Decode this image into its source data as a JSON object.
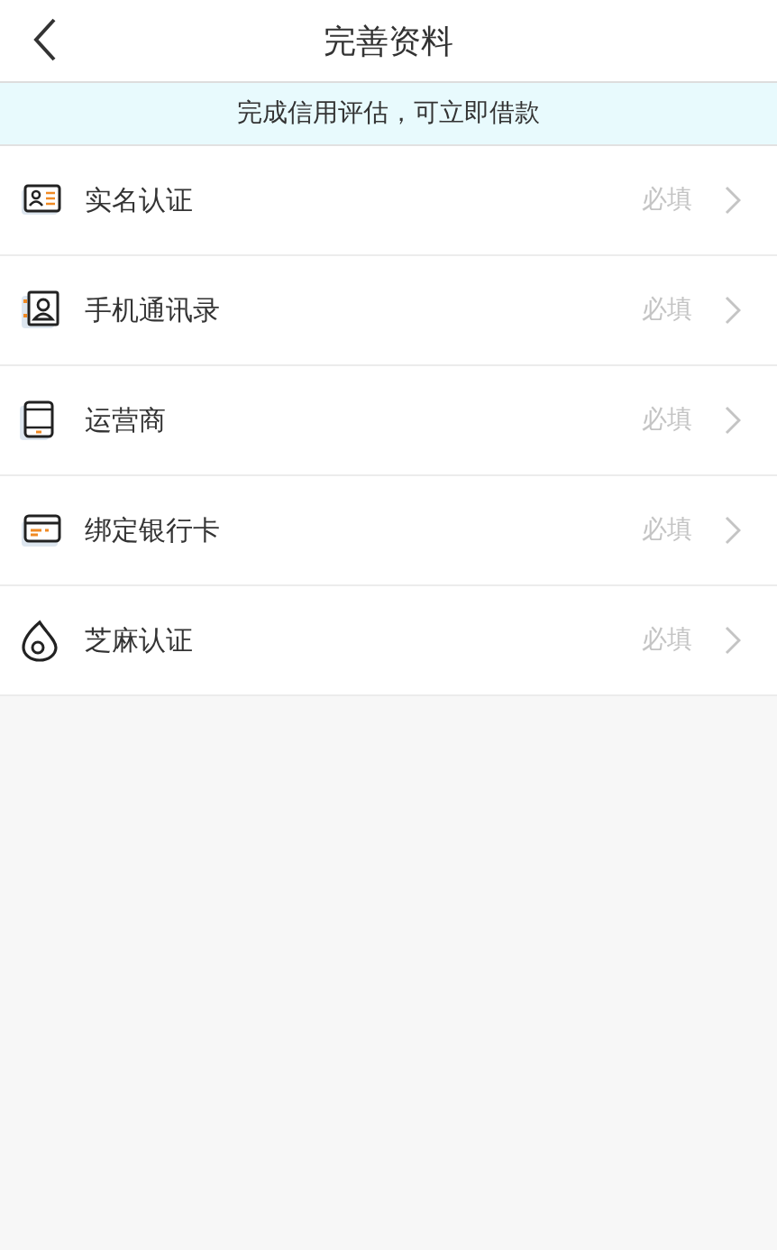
{
  "header": {
    "title": "完善资料"
  },
  "notice": "完成信用评估，可立即借款",
  "items": [
    {
      "kind": "id",
      "label": "实名认证",
      "status": "必填"
    },
    {
      "kind": "contacts",
      "label": "手机通讯录",
      "status": "必填"
    },
    {
      "kind": "phone",
      "label": "运营商",
      "status": "必填"
    },
    {
      "kind": "card",
      "label": "绑定银行卡",
      "status": "必填"
    },
    {
      "kind": "sesame",
      "label": "芝麻认证",
      "status": "必填"
    }
  ]
}
